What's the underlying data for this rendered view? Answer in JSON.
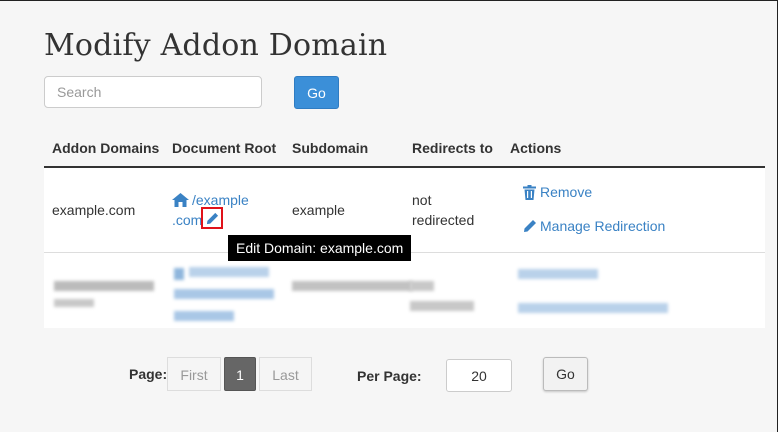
{
  "page": {
    "title": "Modify Addon Domain"
  },
  "search": {
    "placeholder": "Search",
    "go_label": "Go"
  },
  "table": {
    "headers": [
      "Addon Domains",
      "Document Root",
      "Subdomain",
      "Redirects to",
      "Actions"
    ],
    "rows": [
      {
        "domain": "example.com",
        "docroot_line1": "/example",
        "docroot_line2": ".com",
        "subdomain": "example",
        "redirect_line1": "not",
        "redirect_line2": "redirected",
        "action_remove": "Remove",
        "action_manage": "Manage Redirection"
      }
    ]
  },
  "tooltip": {
    "text": "Edit Domain: example.com"
  },
  "pagination": {
    "page_label": "Page:",
    "first_label": "First",
    "current_page": "1",
    "last_label": "Last",
    "per_page_label": "Per Page:",
    "per_page_value": "20",
    "go_label": "Go"
  },
  "colors": {
    "primary": "#3b8fd8",
    "link": "#3a82c4",
    "highlight": "#e0121a"
  },
  "icons": {
    "home": "home-icon",
    "edit": "pencil-icon",
    "remove": "trash-icon",
    "manage": "pencil-icon"
  }
}
